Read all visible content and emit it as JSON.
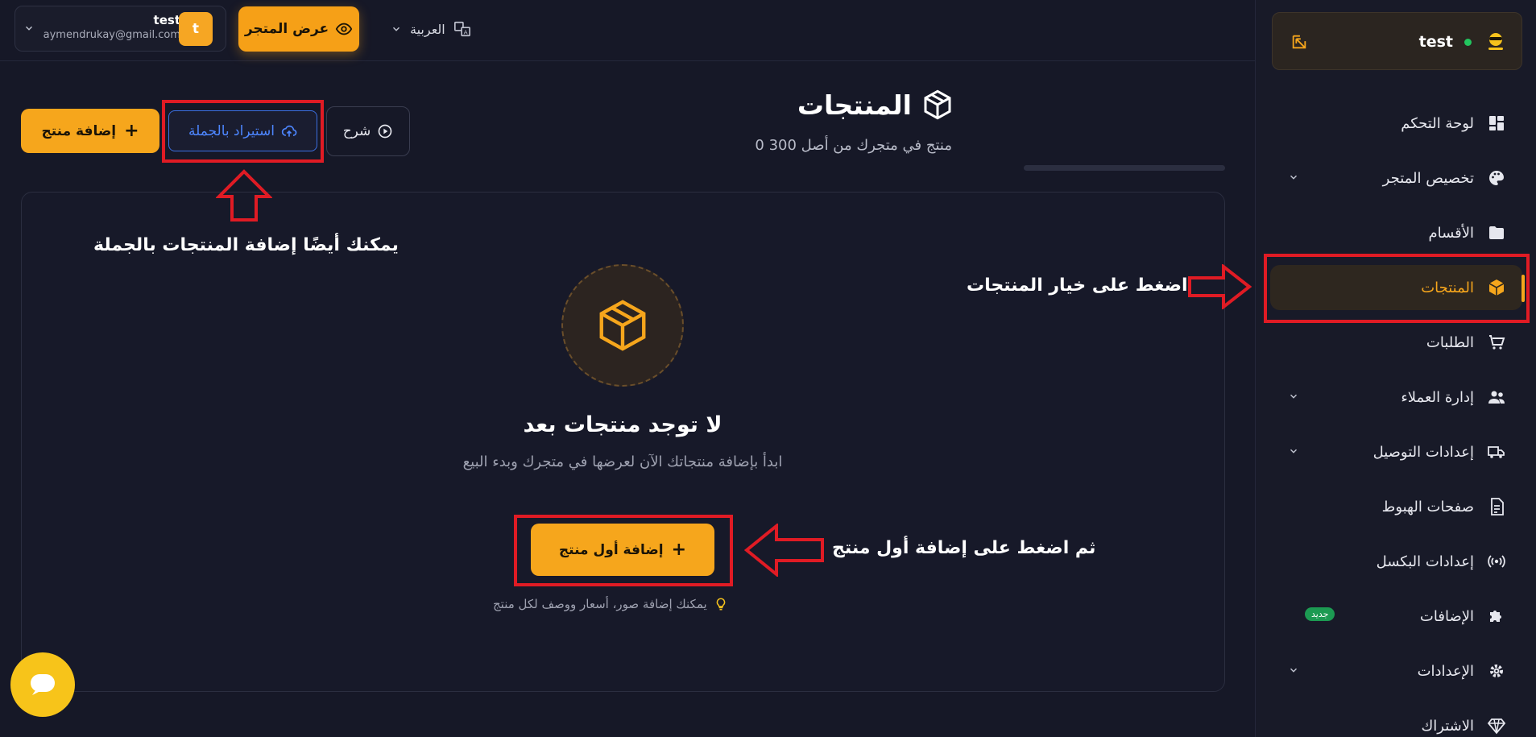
{
  "topbar": {
    "user_name": "test",
    "user_email": "aymendrukay@gmail.com",
    "avatar_letter": "t",
    "view_store_label": "عرض المتجر",
    "language_label": "العربية"
  },
  "header": {
    "title": "المنتجات",
    "subtitle": "0 منتج في متجرك من أصل 300",
    "add_product_label": "إضافة منتج",
    "bulk_import_label": "استيراد بالجملة",
    "explain_label": "شرح"
  },
  "empty_state": {
    "title": "لا توجد منتجات بعد",
    "description": "ابدأ بإضافة منتجاتك الآن لعرضها في متجرك وبدء البيع",
    "add_first_label": "إضافة أول منتج",
    "tip": "يمكنك إضافة صور، أسعار ووصف لكل منتج"
  },
  "annotations": {
    "bulk_hint": "يمكنك أيضًا إضافة المنتجات بالجملة",
    "click_products": "اضغط على خيار المنتجات",
    "click_first": "ثم اضغط على إضافة أول منتج"
  },
  "sidebar": {
    "store_name": "test",
    "items": [
      {
        "label": "لوحة التحكم",
        "icon": "dashboard-icon"
      },
      {
        "label": "تخصيص المتجر",
        "icon": "palette-icon"
      },
      {
        "label": "الأقسام",
        "icon": "folder-icon"
      },
      {
        "label": "المنتجات",
        "icon": "box-icon"
      },
      {
        "label": "الطلبات",
        "icon": "cart-icon"
      },
      {
        "label": "إدارة العملاء",
        "icon": "users-icon"
      },
      {
        "label": "إعدادات التوصيل",
        "icon": "truck-icon"
      },
      {
        "label": "صفحات الهبوط",
        "icon": "file-icon"
      },
      {
        "label": "إعدادات البكسل",
        "icon": "broadcast-icon"
      },
      {
        "label": "الإضافات",
        "icon": "puzzle-icon",
        "badge": "جديد"
      },
      {
        "label": "الإعدادات",
        "icon": "gear-icon"
      },
      {
        "label": "الاشتراك",
        "icon": "diamond-icon"
      }
    ]
  },
  "colors": {
    "accent": "#f6a61c",
    "background": "#161827",
    "annotation_red": "#e01b24",
    "link_blue": "#4d86ff"
  }
}
